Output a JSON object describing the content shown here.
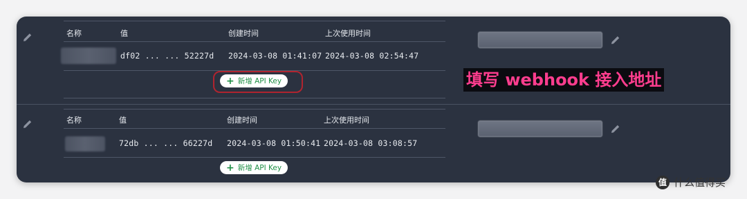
{
  "headers": {
    "name": "名称",
    "value": "值",
    "created": "创建时间",
    "last_used": "上次使用时间"
  },
  "accounts": [
    {
      "api_value": "df02 ... ... 52227d",
      "created": "2024-03-08 01:41:07",
      "last_used": "2024-03-08 02:54:47",
      "add_button_label": "新增 API Key"
    },
    {
      "api_value": "72db ... ... 66227d",
      "created": "2024-03-08 01:50:41",
      "last_used": "2024-03-08 03:08:57",
      "add_button_label": "新增 API Key"
    }
  ],
  "annotation": "填写 webhook 接入地址",
  "watermark": {
    "logo_text": "值",
    "text": "什么值得买"
  },
  "colors": {
    "card_bg": "#2b3240",
    "annotation_text": "#ff3d8e",
    "highlight_border": "#b0242f",
    "button_text": "#1f8f46"
  },
  "icons": {
    "edit": "pencil-icon",
    "add": "plus-icon"
  }
}
